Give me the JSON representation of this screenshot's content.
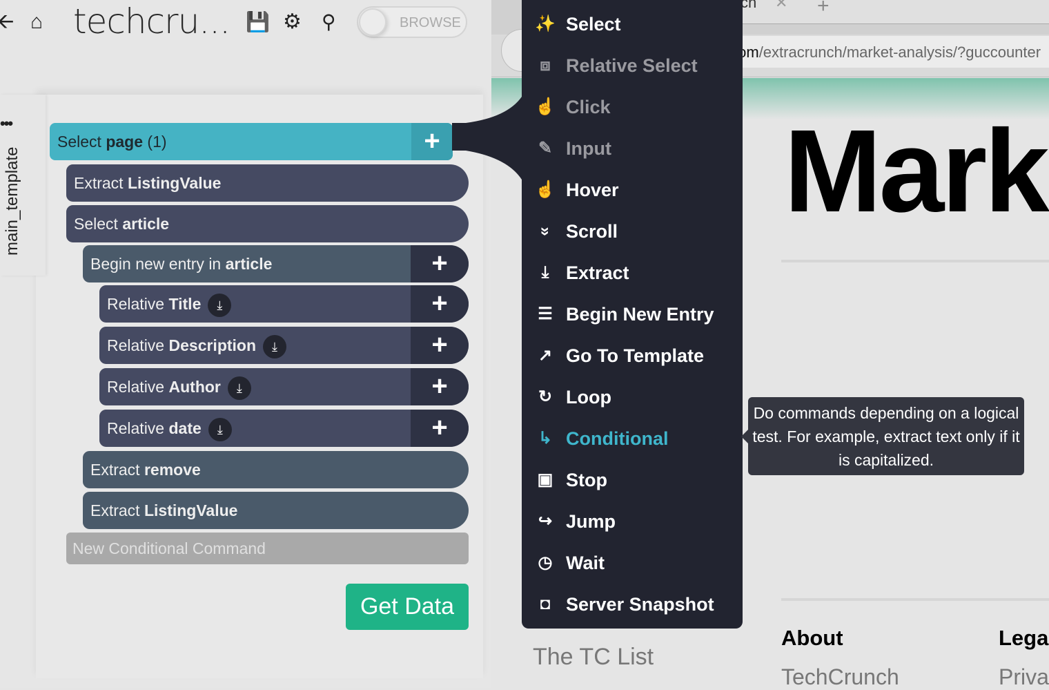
{
  "header": {
    "title": "techcru...",
    "toggle_label": "BROWSE"
  },
  "sidebar": {
    "tab_label": "main_template",
    "more": "•••"
  },
  "commands": [
    {
      "verb": "Select",
      "target": "page",
      "suffix": "(1)"
    },
    {
      "verb": "Extract",
      "target": "ListingValue"
    },
    {
      "verb": "Select",
      "target": "article"
    },
    {
      "verb": "Begin new entry in",
      "target": "article"
    },
    {
      "verb": "Relative",
      "target": "Title"
    },
    {
      "verb": "Relative",
      "target": "Description"
    },
    {
      "verb": "Relative",
      "target": "Author"
    },
    {
      "verb": "Relative",
      "target": "date"
    },
    {
      "verb": "Extract",
      "target": "remove"
    },
    {
      "verb": "Extract",
      "target": "ListingValue"
    },
    {
      "verb": "New Conditional Command"
    }
  ],
  "get_data_label": "Get Data",
  "browser": {
    "tab_fragment": "ch",
    "url_domain": ".com",
    "url_path": "/extracrunch/market-analysis/?guccounter",
    "heading": "Mark",
    "list_link": "The TC List",
    "footer": {
      "about": "About",
      "legal": "Lega",
      "techcrunch": "TechCrunch",
      "privacy": "Privac"
    }
  },
  "menu": {
    "items": [
      {
        "label": "Select",
        "icon": "magic-wand-icon",
        "state": "enabled"
      },
      {
        "label": "Relative Select",
        "icon": "relative-select-icon",
        "state": "disabled"
      },
      {
        "label": "Click",
        "icon": "pointer-hand-icon",
        "state": "disabled"
      },
      {
        "label": "Input",
        "icon": "pencil-icon",
        "state": "disabled"
      },
      {
        "label": "Hover",
        "icon": "hand-icon",
        "state": "enabled"
      },
      {
        "label": "Scroll",
        "icon": "double-chevron-down-icon",
        "state": "enabled"
      },
      {
        "label": "Extract",
        "icon": "download-icon",
        "state": "enabled"
      },
      {
        "label": "Begin New Entry",
        "icon": "list-icon",
        "state": "enabled"
      },
      {
        "label": "Go To Template",
        "icon": "external-link-icon",
        "state": "enabled"
      },
      {
        "label": "Loop",
        "icon": "loop-icon",
        "state": "enabled"
      },
      {
        "label": "Conditional",
        "icon": "branch-icon",
        "state": "active"
      },
      {
        "label": "Stop",
        "icon": "stop-icon",
        "state": "enabled"
      },
      {
        "label": "Jump",
        "icon": "share-arrow-icon",
        "state": "enabled"
      },
      {
        "label": "Wait",
        "icon": "clock-icon",
        "state": "enabled"
      },
      {
        "label": "Server Snapshot",
        "icon": "camera-icon",
        "state": "enabled"
      }
    ]
  },
  "tooltip": "Do commands depending on a logical test. For example, extract text only if it is capitalized.",
  "colors": {
    "select_page": "#45b3c4",
    "command": "#454a62",
    "entry": "#4a5a6a",
    "menu_bg": "#222430",
    "active": "#3fb6cc",
    "get_data": "#1fb387"
  }
}
